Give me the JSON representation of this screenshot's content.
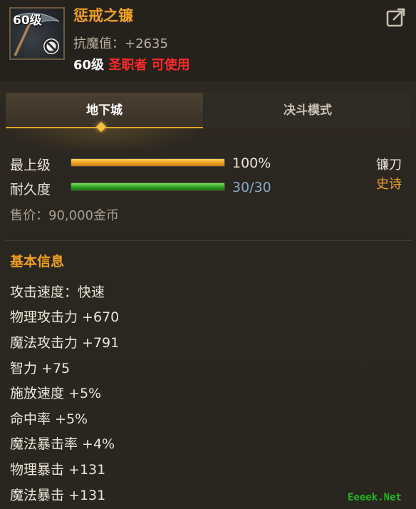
{
  "item": {
    "level_badge": "60级",
    "name": "惩戒之镰",
    "stat_line": "抗魔值：+2635",
    "req_level": "60级",
    "req_class": "圣职者 可使用"
  },
  "tabs": [
    {
      "label": "地下城",
      "active": true
    },
    {
      "label": "决斗模式",
      "active": false
    }
  ],
  "bars": {
    "grade": {
      "label": "最上级",
      "value_text": "100%",
      "fraction": 1.0,
      "color": "#f0a020"
    },
    "durability": {
      "label": "耐久度",
      "value_text": "30/30",
      "fraction": 1.0,
      "color": "#2ea020"
    }
  },
  "weapon_type": "镰刀",
  "rarity": {
    "label": "史诗",
    "color": "#f0a020"
  },
  "price": "售价：90,000金币",
  "basic_info": {
    "title": "基本信息",
    "attributes": [
      "攻击速度：快速",
      "物理攻击力 +670",
      "魔法攻击力 +791",
      "智力 +75",
      "施放速度 +5%",
      "命中率 +5%",
      "魔法暴击率 +4%",
      "物理暴击 +131",
      "魔法暴击 +131"
    ]
  },
  "watermark": "Eeeek.Net",
  "icons": {
    "share": "share-icon",
    "forbidden": "forbidden-icon",
    "scythe": "scythe-icon"
  }
}
